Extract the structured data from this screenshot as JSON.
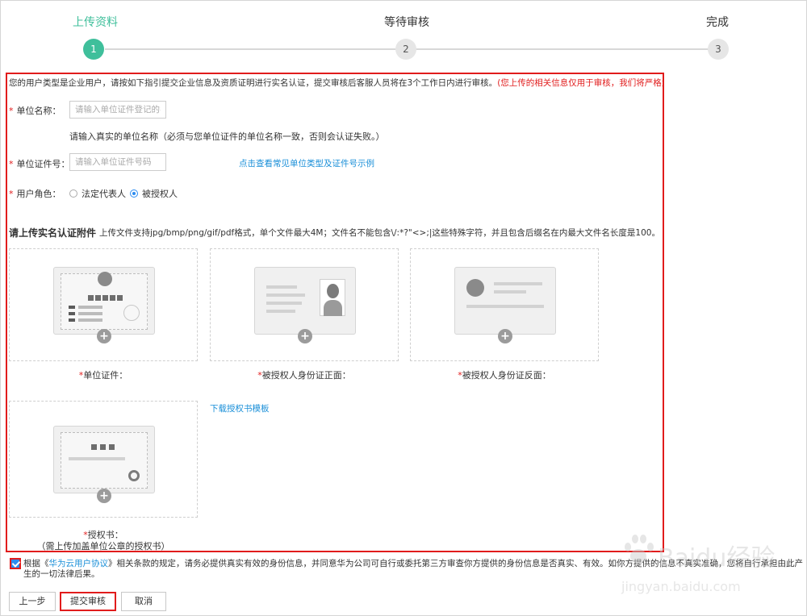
{
  "stepper": {
    "steps": [
      {
        "label": "上传资料",
        "number": "1",
        "active": true
      },
      {
        "label": "等待审核",
        "number": "2",
        "active": false
      },
      {
        "label": "完成",
        "number": "3",
        "active": false
      }
    ]
  },
  "notice": {
    "text": "您的用户类型是企业用户，请按如下指引提交企业信息及资质证明进行实名认证，提交审核后客服人员将在3个工作日内进行审核。",
    "warning": "(您上传的相关信息仅用于审核，我们将严格为您保密"
  },
  "form": {
    "required_mark": "*",
    "org_name": {
      "label": "单位名称：",
      "placeholder": "请输入单位证件登记的名",
      "value": "",
      "hint": "请输入真实的单位名称（必须与您单位证件的单位名称一致，否则会认证失败。）"
    },
    "org_id": {
      "label": "单位证件号：",
      "placeholder": "请输入单位证件号码",
      "value": "",
      "example_link": "点击查看常见单位类型及证件号示例"
    },
    "role": {
      "label": "用户角色：",
      "options": [
        "法定代表人",
        "被授权人"
      ],
      "selected": "被授权人"
    }
  },
  "attachments": {
    "title": "请上传实名认证附件",
    "description": "上传文件支持jpg/bmp/png/gif/pdf格式，单个文件最大4M；文件名不能包含\\/:*?\"<>;|这些特殊字符，并且包含后缀名在内最大文件名长度是100。",
    "uploads": [
      {
        "caption": "单位证件：",
        "icon": "business-license-icon"
      },
      {
        "caption": "被授权人身份证正面：",
        "icon": "id-card-front-icon"
      },
      {
        "caption": "被授权人身份证反面：",
        "icon": "id-card-back-icon"
      },
      {
        "caption": "授权书：",
        "icon": "authorization-letter-icon",
        "note": "（需上传加盖单位公章的授权书）"
      }
    ],
    "template_link": "下载授权书模板",
    "plus_symbol": "+"
  },
  "agreement": {
    "checked": true,
    "prefix": "根据《",
    "link": "华为云用户协议",
    "text": "》相关条款的规定，请务必提供真实有效的身份信息，并同意华为公司可自行或委托第三方审查你方提供的身份信息是否真实、有效。如你方提供",
    "hidden_part": "的信息不真实准确，您将自行承担由此产生",
    "suffix": "的一切法律后果。"
  },
  "buttons": {
    "prev": "上一步",
    "submit": "提交审核",
    "cancel": "取消"
  },
  "watermark": {
    "text1": "Baidu经验",
    "text2": "jingyan.baidu.com"
  },
  "colors": {
    "accent": "#3fbf9b",
    "link": "#1a8fd8",
    "highlight": "#e11c1c",
    "radio": "#2d8cf0"
  }
}
